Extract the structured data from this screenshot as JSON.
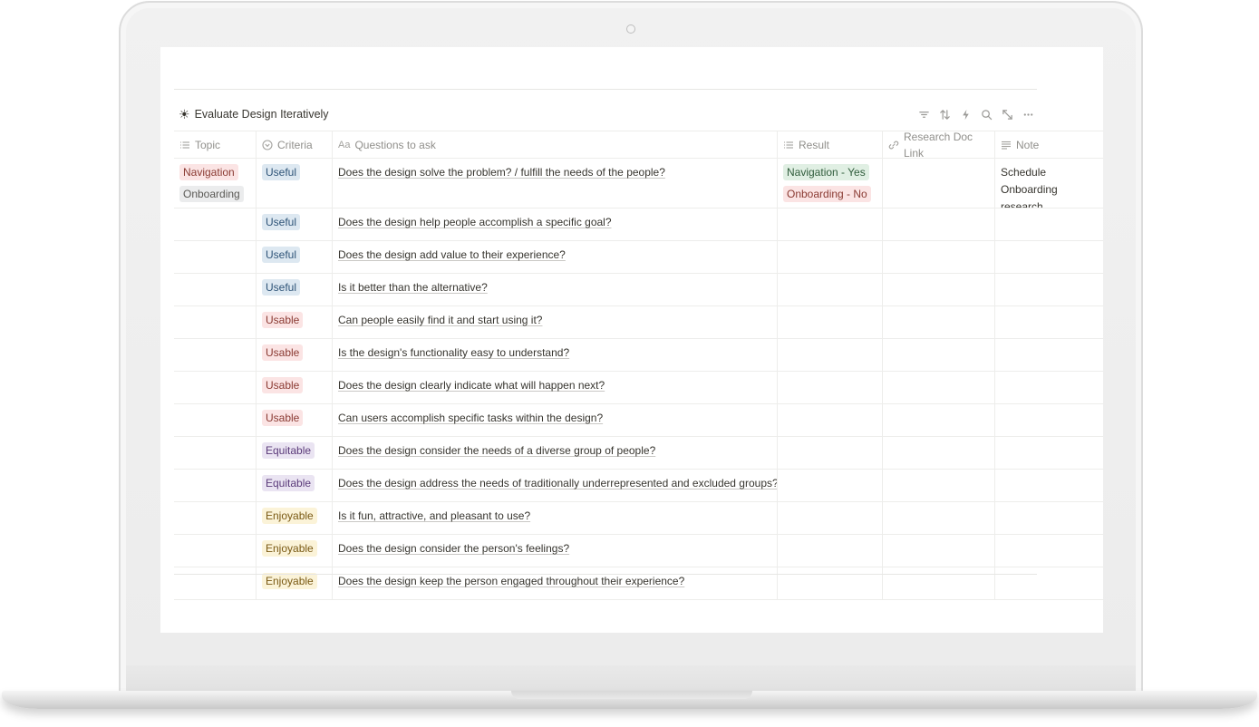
{
  "database": {
    "title": "Evaluate Design Iteratively",
    "title_icon": "sun-icon"
  },
  "toolbar": {
    "icons": [
      "filter-icon",
      "sort-icon",
      "lightning-icon",
      "search-icon",
      "expand-icon",
      "more-icon"
    ]
  },
  "columns": {
    "topic": "Topic",
    "criteria": "Criteria",
    "questions": "Questions to ask",
    "result": "Result",
    "link": "Research Doc Link",
    "note": "Note"
  },
  "colors": {
    "red_tag": "#fbe4e4",
    "gray_tag": "#ebeced",
    "blue_tag": "#dde8f1",
    "purple_tag": "#eae4f2",
    "yellow_tag": "#fbf3d8",
    "green_tag": "#e0efe3"
  },
  "rows": [
    {
      "topics": [
        "Navigation",
        "Onboarding"
      ],
      "criteria": "Useful",
      "question": "Does the design solve the problem? / fulfill the needs of the people?",
      "results": [
        "Navigation - Yes",
        "Onboarding - No"
      ],
      "link": "",
      "note": "Schedule Onboarding research"
    },
    {
      "criteria": "Useful",
      "question": "Does the design help people accomplish a specific goal?"
    },
    {
      "criteria": "Useful",
      "question": "Does the design add value to their experience?"
    },
    {
      "criteria": "Useful",
      "question": "Is it better than the alternative?"
    },
    {
      "criteria": "Usable",
      "question": "Can people easily find it and start using it?"
    },
    {
      "criteria": "Usable",
      "question": "Is the design's functionality easy to understand?"
    },
    {
      "criteria": "Usable",
      "question": "Does the design clearly indicate what will happen next?"
    },
    {
      "criteria": "Usable",
      "question": "Can users accomplish specific tasks within the design?"
    },
    {
      "criteria": "Equitable",
      "question": "Does the design consider the needs of a diverse group of people?"
    },
    {
      "criteria": "Equitable",
      "question": "Does the design address the needs of traditionally underrepresented and excluded groups?"
    },
    {
      "criteria": "Enjoyable",
      "question": "Is it fun, attractive, and pleasant to use?"
    },
    {
      "criteria": "Enjoyable",
      "question": "Does the design consider the person's feelings?"
    },
    {
      "criteria": "Enjoyable",
      "question": "Does the design keep the person engaged throughout their experience?"
    }
  ]
}
